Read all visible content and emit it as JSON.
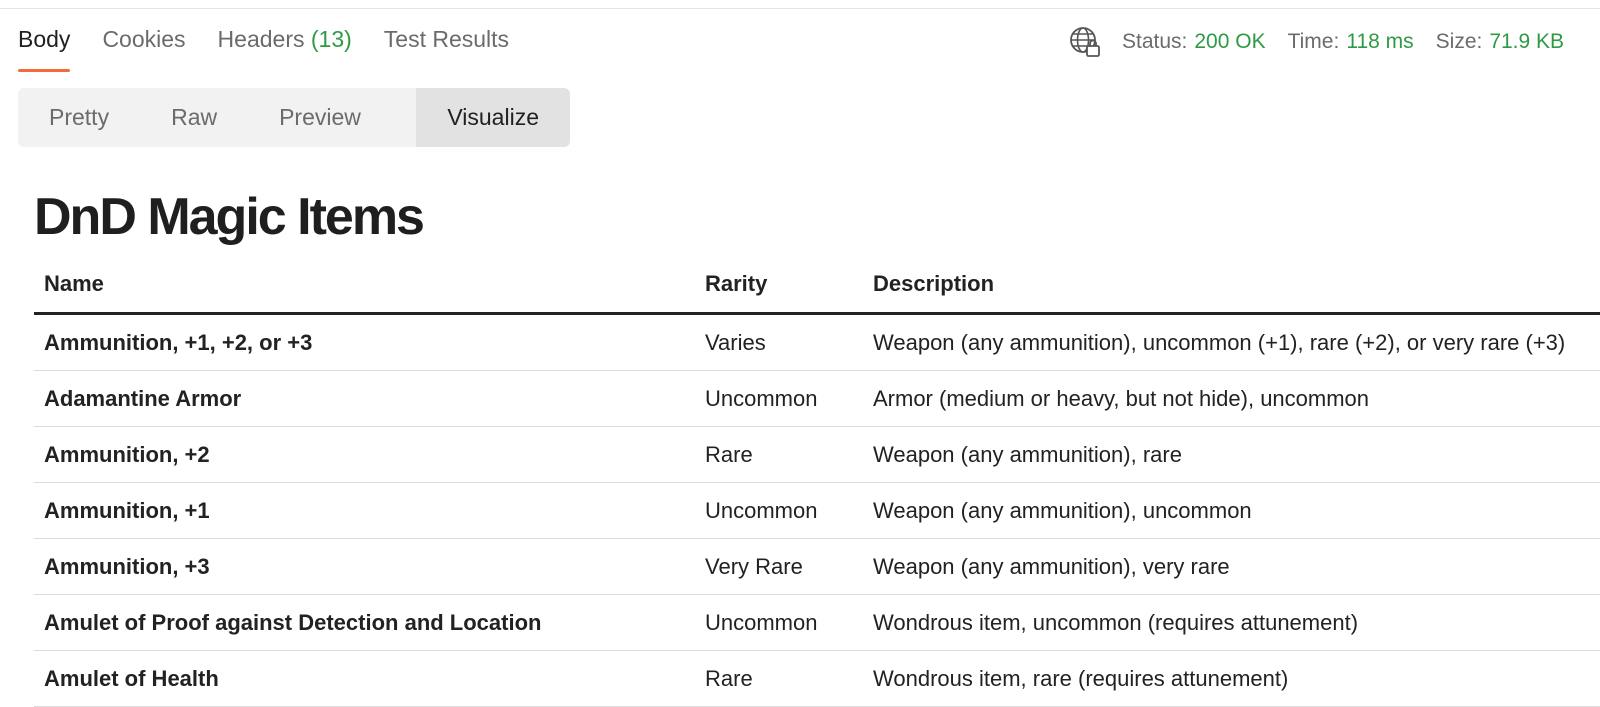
{
  "response_tabs": [
    {
      "label": "Body",
      "active": true
    },
    {
      "label": "Cookies"
    },
    {
      "label": "Headers",
      "count": "(13)"
    },
    {
      "label": "Test Results"
    }
  ],
  "status": {
    "icon": "globe-lock-icon",
    "status_label": "Status:",
    "status_value": "200 OK",
    "time_label": "Time:",
    "time_value": "118 ms",
    "size_label": "Size:",
    "size_value": "71.9 KB"
  },
  "view_modes": [
    "Pretty",
    "Raw",
    "Preview",
    "Visualize"
  ],
  "active_view_mode": "Visualize",
  "visualization": {
    "title": "DnD Magic Items",
    "columns": [
      "Name",
      "Rarity",
      "Description"
    ],
    "rows": [
      {
        "name": "Ammunition, +1, +2, or +3",
        "rarity": "Varies",
        "description": "Weapon (any ammunition), uncommon (+1), rare (+2), or very rare (+3)"
      },
      {
        "name": "Adamantine Armor",
        "rarity": "Uncommon",
        "description": "Armor (medium or heavy, but not hide), uncommon"
      },
      {
        "name": "Ammunition, +2",
        "rarity": "Rare",
        "description": "Weapon (any ammunition), rare"
      },
      {
        "name": "Ammunition, +1",
        "rarity": "Uncommon",
        "description": "Weapon (any ammunition), uncommon"
      },
      {
        "name": "Ammunition, +3",
        "rarity": "Very Rare",
        "description": "Weapon (any ammunition), very rare"
      },
      {
        "name": "Amulet of Proof against Detection and Location",
        "rarity": "Uncommon",
        "description": "Wondrous item, uncommon (requires attunement)"
      },
      {
        "name": "Amulet of Health",
        "rarity": "Rare",
        "description": "Wondrous item, rare (requires attunement)"
      }
    ]
  },
  "colors": {
    "accent": "#f26b3a",
    "success": "#2f9a45"
  }
}
